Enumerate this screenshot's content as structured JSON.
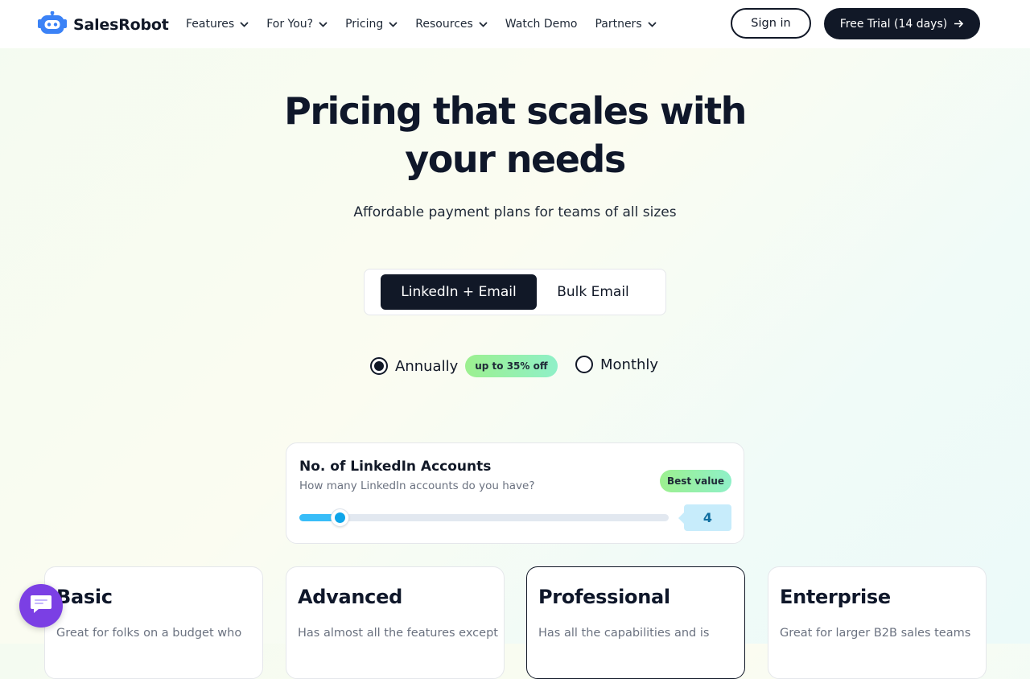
{
  "brand": {
    "name": "SalesRobot",
    "logo_icon": "robot-icon",
    "accent": "#3b82f6"
  },
  "nav": {
    "items": [
      {
        "label": "Features",
        "has_dropdown": true
      },
      {
        "label": "For You?",
        "has_dropdown": true
      },
      {
        "label": "Pricing",
        "has_dropdown": true
      },
      {
        "label": "Resources",
        "has_dropdown": true
      },
      {
        "label": "Watch Demo",
        "has_dropdown": false
      },
      {
        "label": "Partners",
        "has_dropdown": true
      }
    ],
    "sign_in": "Sign in",
    "trial": "Free Trial (14 days)"
  },
  "hero": {
    "title_line1": "Pricing that scales with",
    "title_line2": "your needs",
    "subtitle": "Affordable payment plans for teams of all sizes"
  },
  "channel_toggle": {
    "options": [
      "LinkedIn + Email",
      "Bulk Email"
    ],
    "selected": "LinkedIn + Email"
  },
  "billing": {
    "annually": "Annually",
    "discount_badge": "up to 35% off",
    "monthly": "Monthly",
    "selected": "Annually"
  },
  "accounts": {
    "title": "No. of LinkedIn Accounts",
    "subtitle": "How many LinkedIn accounts do you have?",
    "badge": "Best value",
    "value": "4",
    "slider_fraction": 0.11
  },
  "plans": [
    {
      "name": "Basic",
      "desc": "Great for folks on a budget who"
    },
    {
      "name": "Advanced",
      "desc": "Has almost all the features except"
    },
    {
      "name": "Professional",
      "desc": "Has all the capabilities and is",
      "highlighted": true
    },
    {
      "name": "Enterprise",
      "desc": "Great for larger B2B sales teams"
    }
  ],
  "chat_widget": {
    "icon": "chat-bubble-icon",
    "color": "#7b3fe4"
  }
}
